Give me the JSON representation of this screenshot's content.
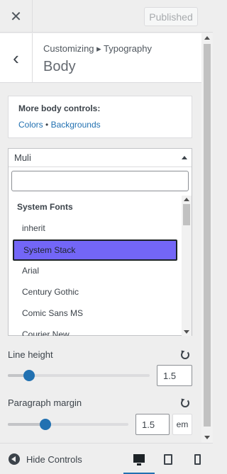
{
  "header": {
    "close_icon": "close-icon",
    "publish_label": "Published"
  },
  "section": {
    "breadcrumb": "Customizing ▸ Typography",
    "title": "Body"
  },
  "more_controls": {
    "title": "More body controls:",
    "link_colors": "Colors",
    "separator": "•",
    "link_backgrounds": "Backgrounds"
  },
  "font_select": {
    "current": "Muli",
    "search_value": "",
    "group_label": "System Fonts",
    "options": [
      "inherit",
      "System Stack",
      "Arial",
      "Century Gothic",
      "Comic Sans MS",
      "Courier New"
    ],
    "selected_index": 1,
    "highlight_color": "#7366f7"
  },
  "line_height": {
    "label": "Line height",
    "value": "1.5",
    "slider_fraction": 0.15
  },
  "paragraph_margin": {
    "label": "Paragraph margin",
    "value": "1.5",
    "unit": "em",
    "slider_fraction": 0.31
  },
  "footer": {
    "hide_label": "Hide Controls",
    "devices": [
      "desktop-icon",
      "tablet-icon",
      "mobile-icon"
    ],
    "active_device": "desktop"
  },
  "colors": {
    "accent": "#2271b1",
    "link": "#2271b1"
  }
}
